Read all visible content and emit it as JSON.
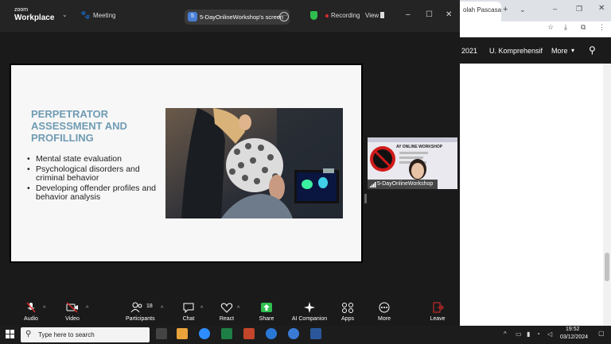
{
  "browser": {
    "tab_title": "olah Pascasar",
    "nav_items": [
      "2021",
      "U. Komprehensif",
      "More"
    ]
  },
  "zoom": {
    "logo_top": "zoom",
    "logo_bottom": "Workplace",
    "meeting_label": "Meeting",
    "share_badge": "5",
    "share_label": "5-DayOnlineWorkshop's screen",
    "recording_label": "Recording",
    "view_label": "View",
    "colors": {
      "recording": "#e02a2a",
      "shield": "#2fbf4f",
      "share_button": "#2fbf4f",
      "leave": "#e02a2a"
    }
  },
  "slide": {
    "title_lines": [
      "PERPETRATOR",
      "ASSESSMENT AND",
      "PROFILLING"
    ],
    "title_color": "#6f9bb3",
    "bullets": [
      "Mental state evaluation",
      "Psychological disorders and criminal behavior",
      "Developing offender profiles and behavior analysis"
    ],
    "bullet_marker": "•"
  },
  "participant": {
    "name": "5-DayOnlineWorkshop",
    "banner_text": "AY ONLINE WORKSHOP"
  },
  "toolbar": {
    "audio": "Audio",
    "video": "Video",
    "participants": "Participants",
    "participants_count": "18",
    "chat": "Chat",
    "react": "React",
    "share": "Share",
    "ai_companion": "AI Companion",
    "apps": "Apps",
    "more": "More",
    "leave": "Leave"
  },
  "taskbar": {
    "search_placeholder": "Type here to search",
    "time": "19:52",
    "date": "03/12/2024"
  }
}
